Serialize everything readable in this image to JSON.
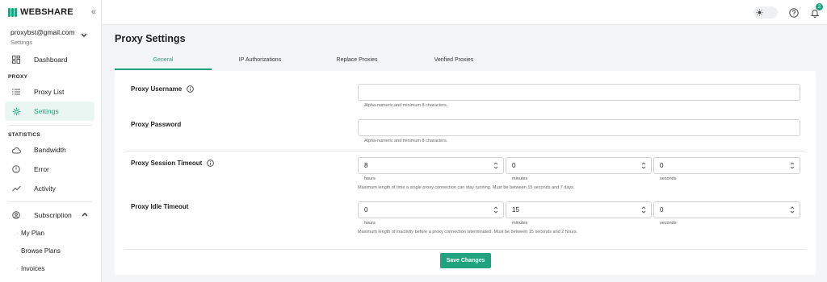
{
  "brand": {
    "name": "WEBSHARE",
    "accent": "#21a27e"
  },
  "account": {
    "email": "proxybst@gmail.com",
    "subtitle": "Settings"
  },
  "sidebar": {
    "dashboard": "Dashboard",
    "section_proxy": "PROXY",
    "proxy_list": "Proxy List",
    "settings": "Settings",
    "section_statistics": "STATISTICS",
    "bandwidth": "Bandwidth",
    "error": "Error",
    "activity": "Activity",
    "subscription": "Subscription",
    "my_plan": "My Plan",
    "browse_plans": "Browse Plans",
    "invoices": "Invoices"
  },
  "topbar": {
    "notification_count": "2"
  },
  "page": {
    "title": "Proxy Settings"
  },
  "tabs": [
    "General",
    "IP Authorizations",
    "Replace Proxies",
    "Verified Proxies"
  ],
  "form": {
    "username_label": "Proxy Username",
    "username_hint": "Alpha-numeric and minimum 8 characters.",
    "password_label": "Proxy Password",
    "password_hint": "Alpha-numeric and minimum 8 characters.",
    "session_label": "Proxy Session Timeout",
    "session": {
      "hours": "8",
      "minutes": "0",
      "seconds": "0"
    },
    "session_hint": "Maximum length of time a single proxy connection can stay running. Must be between 15 seconds and 7 days.",
    "idle_label": "Proxy Idle Timeout",
    "idle": {
      "hours": "0",
      "minutes": "15",
      "seconds": "0"
    },
    "idle_hint": "Maximum length of inactivity before a proxy connection isterminated. Must be between 15 seconds and 2 hours.",
    "unit_hours": "hours",
    "unit_minutes": "minutes",
    "unit_seconds": "seconds",
    "save_label": "Save Changes"
  }
}
